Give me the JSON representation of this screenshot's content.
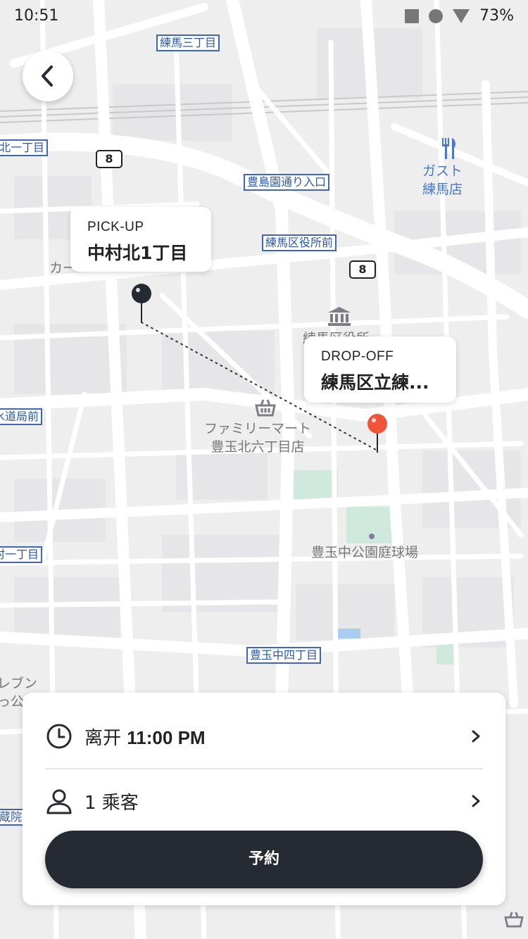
{
  "status_bar": {
    "time": "10:51",
    "battery": "73%"
  },
  "map": {
    "stations": [
      {
        "id": "nerima-3",
        "label": "練馬三丁目"
      },
      {
        "id": "kita-1",
        "label": "北一丁目"
      },
      {
        "id": "toshimaen",
        "label": "豊島園通り入口"
      },
      {
        "id": "kuyakusho",
        "label": "練馬区役所前"
      },
      {
        "id": "suido",
        "label": "水道局前"
      },
      {
        "id": "mura-1",
        "label": "村一丁目"
      },
      {
        "id": "toyotamanaka-4",
        "label": "豊玉中四丁目"
      },
      {
        "id": "kura",
        "label": "蔵院"
      }
    ],
    "road_shields": [
      "8",
      "8"
    ],
    "pois": {
      "gusto": "ガスト\n練馬店",
      "family_mart": "ファミリーマート\n豊玉北六丁目店",
      "park": "豊玉中公園庭球場",
      "kuyakusho_building": "練馬区役所",
      "partial_left": "カー",
      "seven_partial": "レブン\nっ公"
    }
  },
  "pickup": {
    "kicker": "PICK-UP",
    "title": "中村北1丁目"
  },
  "dropoff": {
    "kicker": "DROP-OFF",
    "title": "練馬区立練..."
  },
  "booking": {
    "depart_prefix": "离开",
    "depart_time": "11:00 PM",
    "passengers": "1 乘客",
    "book_label": "予約"
  },
  "colors": {
    "pickup_pin": "#262a33",
    "dropoff_pin": "#f0553a",
    "button_bg": "#262a33",
    "station_blue": "#3e67b8"
  }
}
